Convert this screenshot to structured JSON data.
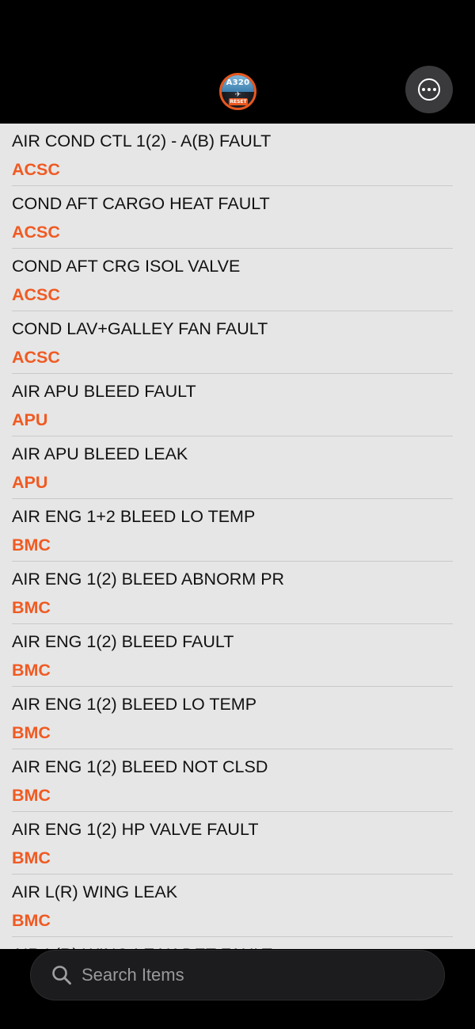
{
  "header": {
    "logo": {
      "top_text": "A320",
      "bottom_text": "RESET"
    },
    "menu_icon": "ellipsis-circle-icon"
  },
  "items": [
    {
      "title": "AIR COND CTL 1(2) - A(B) FAULT",
      "system": "ACSC"
    },
    {
      "title": "COND AFT CARGO HEAT FAULT",
      "system": "ACSC"
    },
    {
      "title": "COND AFT CRG ISOL VALVE",
      "system": "ACSC"
    },
    {
      "title": "COND LAV+GALLEY FAN FAULT",
      "system": "ACSC"
    },
    {
      "title": "AIR APU BLEED FAULT",
      "system": "APU"
    },
    {
      "title": "AIR APU BLEED LEAK",
      "system": "APU"
    },
    {
      "title": "AIR ENG 1+2 BLEED LO TEMP",
      "system": "BMC"
    },
    {
      "title": "AIR ENG 1(2) BLEED ABNORM PR",
      "system": "BMC"
    },
    {
      "title": "AIR ENG 1(2) BLEED FAULT",
      "system": "BMC"
    },
    {
      "title": "AIR ENG 1(2) BLEED LO TEMP",
      "system": "BMC"
    },
    {
      "title": "AIR ENG 1(2) BLEED NOT CLSD",
      "system": "BMC"
    },
    {
      "title": "AIR ENG 1(2) HP VALVE FAULT",
      "system": "BMC"
    },
    {
      "title": "AIR L(R) WING LEAK",
      "system": "BMC"
    },
    {
      "title": "AIR L(R) WING LEAK DET FAULT",
      "system": ""
    }
  ],
  "search": {
    "placeholder": "Search Items",
    "icon": "search-icon"
  },
  "colors": {
    "accent": "#f05a22",
    "list_background": "#e6e6e6",
    "header_background": "#000000"
  }
}
